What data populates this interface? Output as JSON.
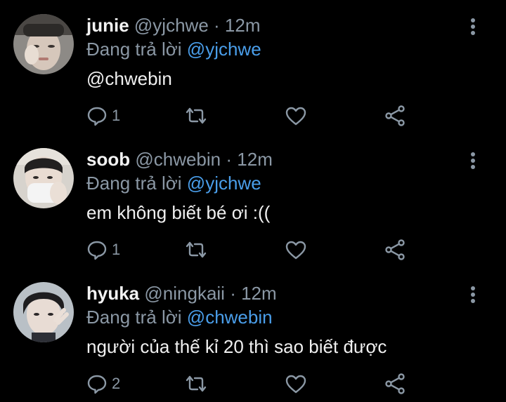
{
  "colors": {
    "background": "#000000",
    "name": "#f2f2f2",
    "muted": "#8b98a5",
    "link": "#4a9eea",
    "body": "#f0f0f0"
  },
  "icons": [
    "reply-icon",
    "retweet-icon",
    "like-icon",
    "share-icon",
    "more-options-icon"
  ],
  "replies": [
    {
      "display_name": "junie",
      "handle": "@yjchwe",
      "separator": "·",
      "time": "12m",
      "replying_prefix": "Đang trả lời",
      "replying_to": "@yjchwe",
      "body": "@chwebin",
      "reply_count": "1",
      "retweet_count": "",
      "like_count": ""
    },
    {
      "display_name": "soob",
      "handle": "@chwebin",
      "separator": "·",
      "time": "12m",
      "replying_prefix": "Đang trả lời",
      "replying_to": "@yjchwe",
      "body": "em không biết bé ơi :((",
      "reply_count": "1",
      "retweet_count": "",
      "like_count": ""
    },
    {
      "display_name": "hyuka",
      "handle": "@ningkaii",
      "separator": "·",
      "time": "12m",
      "replying_prefix": "Đang trả lời",
      "replying_to": "@chwebin",
      "body": "người của thế kỉ 20 thì sao biết được",
      "reply_count": "2",
      "retweet_count": "",
      "like_count": ""
    }
  ]
}
